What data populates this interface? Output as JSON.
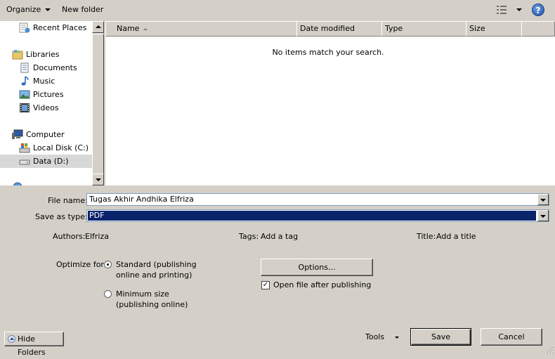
{
  "toolbar": {
    "organize_label": "Organize",
    "new_folder_label": "New folder",
    "help_label": "?"
  },
  "nav": {
    "items": [
      {
        "label": "Recent Places",
        "icon": "recent-places-icon"
      },
      {
        "label": "Libraries",
        "icon": "libraries-icon"
      },
      {
        "label": "Documents",
        "icon": "documents-icon"
      },
      {
        "label": "Music",
        "icon": "music-icon"
      },
      {
        "label": "Pictures",
        "icon": "pictures-icon"
      },
      {
        "label": "Videos",
        "icon": "videos-icon"
      },
      {
        "label": "Computer",
        "icon": "computer-icon"
      },
      {
        "label": "Local Disk (C:)",
        "icon": "local-disk-icon"
      },
      {
        "label": "Data (D:)",
        "icon": "drive-icon"
      }
    ],
    "selected": "Data (D:)"
  },
  "filelist": {
    "columns": [
      "Name",
      "Date modified",
      "Type",
      "Size"
    ],
    "empty_message": "No items match your search."
  },
  "form": {
    "file_name_label": "File name:",
    "file_name_value": "Tugas Akhir Andhika Elfriza",
    "save_type_label": "Save as type:",
    "save_type_value": "PDF",
    "authors_label": "Authors:",
    "authors_value": "Elfriza",
    "tags_label": "Tags:",
    "tags_value": "Add a tag",
    "title_label": "Title:",
    "title_value": "Add a title",
    "optimize_label": "Optimize for:",
    "standard_line1": "Standard (publishing",
    "standard_line2": "online and printing)",
    "minimum_line1": "Minimum size",
    "minimum_line2": "(publishing online)",
    "optimize_selected": "standard",
    "options_label": "Options...",
    "open_after_label": "Open file after publishing",
    "open_after_checked": true,
    "check_mark": "✓"
  },
  "footer": {
    "hide_folders_label": "Hide Folders",
    "tools_label": "Tools",
    "save_label": "Save",
    "cancel_label": "Cancel"
  },
  "colors": {
    "face": "#d4d0c8",
    "selection": "#0a246a",
    "nav_selected": "#d8d8d8"
  }
}
